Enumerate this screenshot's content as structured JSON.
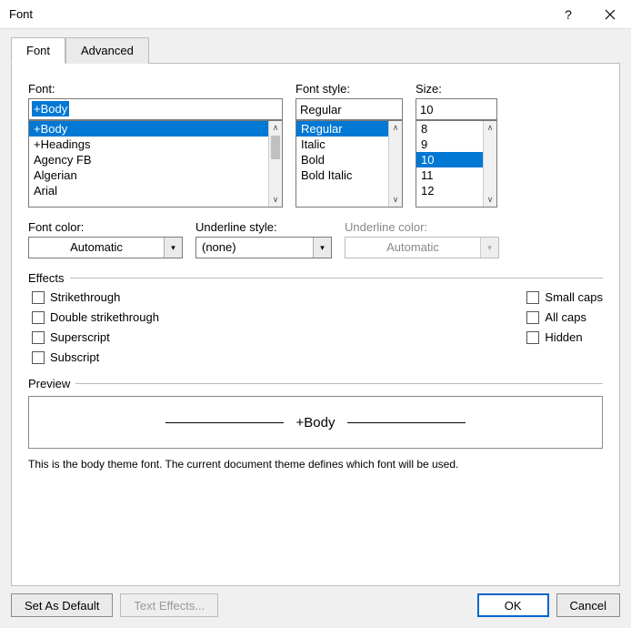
{
  "title": "Font",
  "tabs": {
    "font": "Font",
    "advanced": "Advanced"
  },
  "font": {
    "label": "Font:",
    "value": "+Body",
    "options": [
      "+Body",
      "+Headings",
      "Agency FB",
      "Algerian",
      "Arial"
    ],
    "selected": "+Body"
  },
  "style": {
    "label": "Font style:",
    "value": "Regular",
    "options": [
      "Regular",
      "Italic",
      "Bold",
      "Bold Italic"
    ],
    "selected": "Regular"
  },
  "size": {
    "label": "Size:",
    "value": "10",
    "options": [
      "8",
      "9",
      "10",
      "11",
      "12"
    ],
    "selected": "10"
  },
  "fontColor": {
    "label": "Font color:",
    "value": "Automatic"
  },
  "underlineStyle": {
    "label": "Underline style:",
    "value": "(none)"
  },
  "underlineColor": {
    "label": "Underline color:",
    "value": "Automatic"
  },
  "effects": {
    "label": "Effects",
    "strikethrough": "Strikethrough",
    "doubleStrikethrough": "Double strikethrough",
    "superscript": "Superscript",
    "subscript": "Subscript",
    "smallCaps": "Small caps",
    "allCaps": "All caps",
    "hidden": "Hidden"
  },
  "preview": {
    "label": "Preview",
    "text": "+Body",
    "desc": "This is the body theme font. The current document theme defines which font will be used."
  },
  "buttons": {
    "setDefault": "Set As Default",
    "textEffects": "Text Effects...",
    "ok": "OK",
    "cancel": "Cancel"
  }
}
